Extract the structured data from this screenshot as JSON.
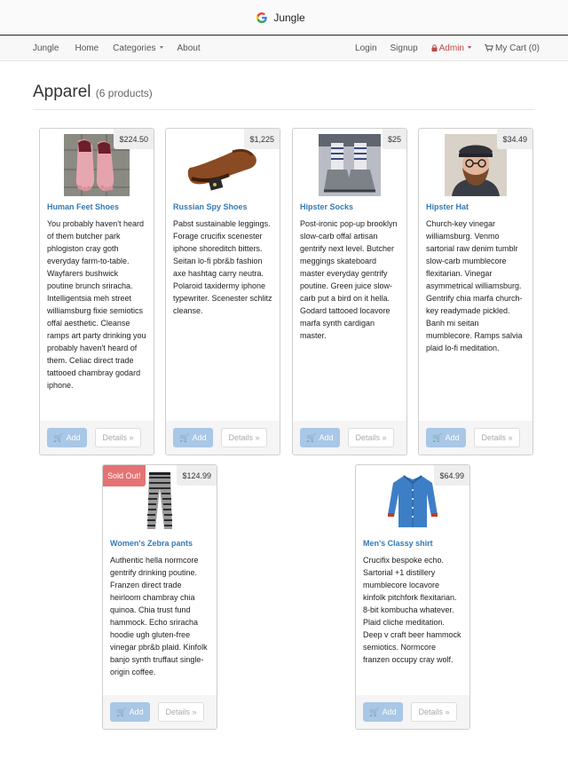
{
  "window": {
    "title": "Jungle"
  },
  "navbar": {
    "brand": "Jungle",
    "home": "Home",
    "categories": "Categories",
    "about": "About",
    "login": "Login",
    "signup": "Signup",
    "admin": "Admin",
    "cart": "My Cart (0)"
  },
  "page": {
    "title": "Apparel",
    "count": "(6 products)"
  },
  "buttons": {
    "add": "Add",
    "details": "Details »"
  },
  "products": [
    {
      "name": "Human Feet Shoes",
      "price": "$224.50",
      "description": "You probably haven't heard of them butcher park phlogiston cray goth everyday farm-to-table. Wayfarers bushwick poutine brunch sriracha. Intelligentsia meh street williamsburg fixie semiotics offal aesthetic. Cleanse ramps art party drinking you probably haven't heard of them. Celiac direct trade tattooed chambray godard iphone."
    },
    {
      "name": "Russian Spy Shoes",
      "price": "$1,225",
      "description": "Pabst sustainable leggings. Forage crucifix scenester iphone shoreditch bitters. Seitan lo-fi pbr&b fashion axe hashtag carry neutra. Polaroid taxidermy iphone typewriter. Scenester schlitz cleanse."
    },
    {
      "name": "Hipster Socks",
      "price": "$25",
      "description": "Post-ironic pop-up brooklyn slow-carb offal artisan gentrify next level. Butcher meggings skateboard master everyday gentrify poutine. Green juice slow-carb put a bird on it hella. Godard tattooed locavore marfa synth cardigan master."
    },
    {
      "name": "Hipster Hat",
      "price": "$34.49",
      "description": "Church-key vinegar williamsburg. Venmo sartorial raw denim tumblr slow-carb mumblecore flexitarian. Vinegar asymmetrical williamsburg. Gentrify chia marfa church-key readymade pickled. Banh mi seitan mumblecore. Ramps salvia plaid lo-fi meditation."
    },
    {
      "name": "Women's Zebra pants",
      "price": "$124.99",
      "badge": "Sold Out!",
      "description": "Authentic hella normcore gentrify drinking poutine. Franzen direct trade heirloom chambray chia quinoa. Chia trust fund hammock. Echo sriracha hoodie ugh gluten-free vinegar pbr&b plaid. Kinfolk banjo synth truffaut single-origin coffee."
    },
    {
      "name": "Men's Classy shirt",
      "price": "$64.99",
      "description": "Crucifix bespoke echo. Sartorial +1 distillery mumblecore locavore kinfolk pitchfork flexitarian. 8-bit kombucha whatever. Plaid cliche meditation. Deep v craft beer hammock semiotics. Normcore franzen occupy cray wolf."
    }
  ],
  "colors": {
    "link": "#337ab7",
    "admin": "#b94a48",
    "add_button": "#a9c7e6",
    "sold_out": "#e57373"
  }
}
